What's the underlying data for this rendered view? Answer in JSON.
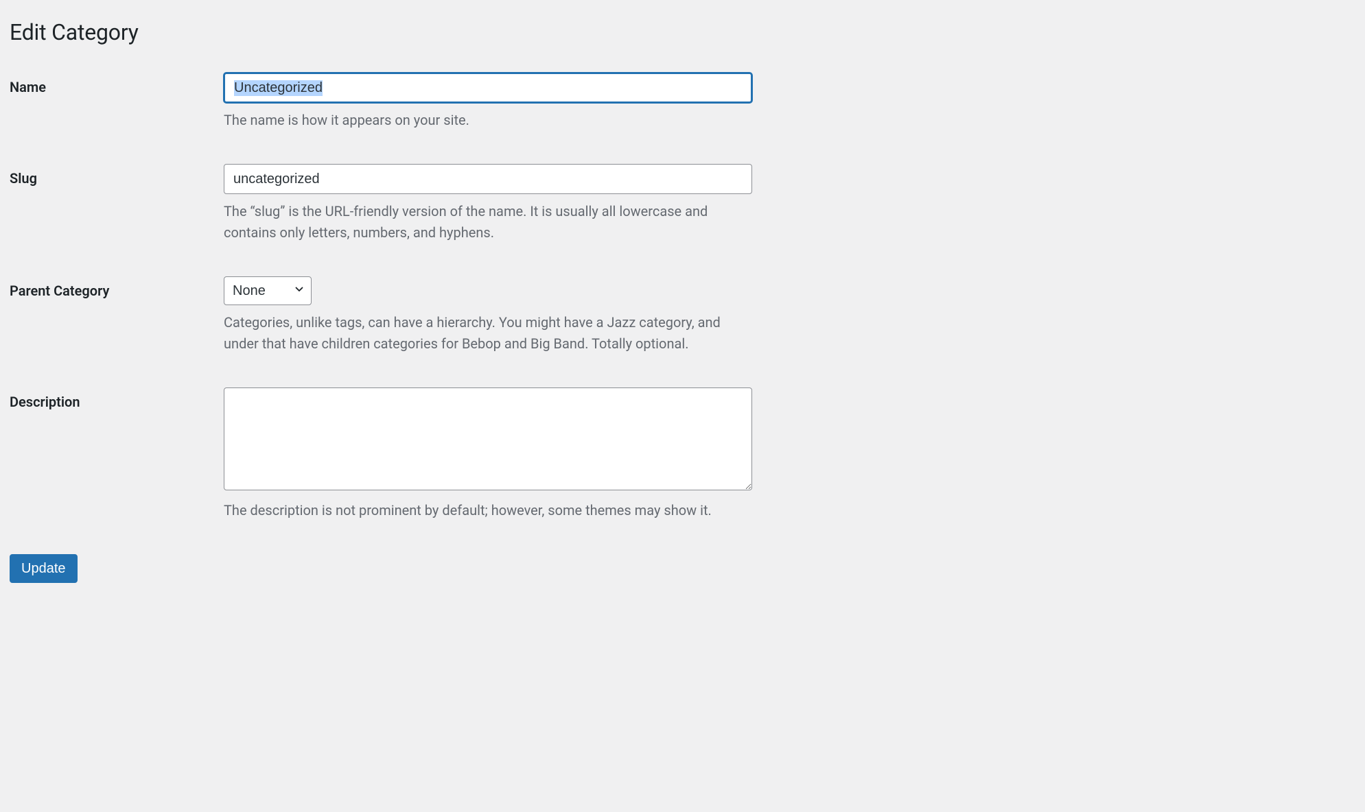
{
  "page": {
    "title": "Edit Category"
  },
  "fields": {
    "name": {
      "label": "Name",
      "value": "Uncategorized",
      "help": "The name is how it appears on your site."
    },
    "slug": {
      "label": "Slug",
      "value": "uncategorized",
      "help": "The “slug” is the URL-friendly version of the name. It is usually all lowercase and contains only letters, numbers, and hyphens."
    },
    "parent": {
      "label": "Parent Category",
      "selected": "None",
      "help": "Categories, unlike tags, can have a hierarchy. You might have a Jazz category, and under that have children categories for Bebop and Big Band. Totally optional."
    },
    "description": {
      "label": "Description",
      "value": "",
      "help": "The description is not prominent by default; however, some themes may show it."
    }
  },
  "actions": {
    "submit_label": "Update"
  }
}
